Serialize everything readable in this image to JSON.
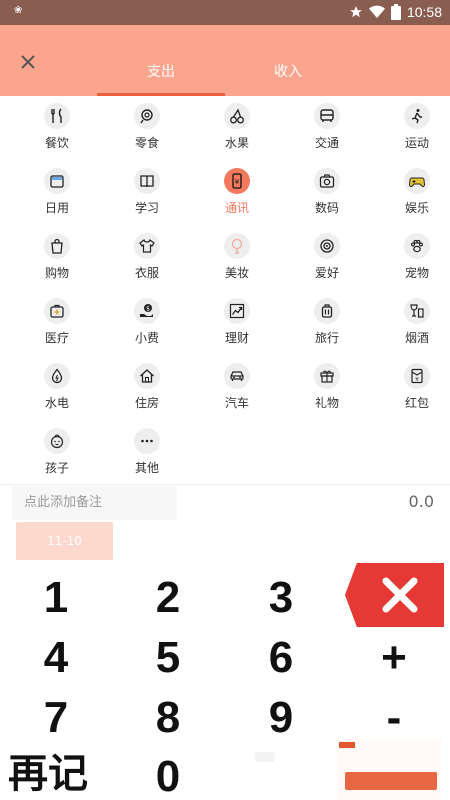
{
  "status_bar": {
    "time": "10:58"
  },
  "header": {
    "tabs": [
      {
        "label": "支出",
        "active": true
      },
      {
        "label": "收入",
        "active": false
      }
    ],
    "colors": {
      "header_bg": "#fca58e",
      "accent": "#ea5f3d",
      "selected_category": "#f2795d"
    }
  },
  "categories": [
    {
      "label": "餐饮",
      "icon": "fork-knife-icon"
    },
    {
      "label": "零食",
      "icon": "candy-icon"
    },
    {
      "label": "水果",
      "icon": "cherry-icon"
    },
    {
      "label": "交通",
      "icon": "bus-icon"
    },
    {
      "label": "运动",
      "icon": "running-icon"
    },
    {
      "label": "日用",
      "icon": "daily-box-icon"
    },
    {
      "label": "学习",
      "icon": "book-icon"
    },
    {
      "label": "通讯",
      "icon": "phone-icon",
      "active": true
    },
    {
      "label": "数码",
      "icon": "camera-icon"
    },
    {
      "label": "娱乐",
      "icon": "gamepad-icon"
    },
    {
      "label": "购物",
      "icon": "shopping-bag-icon"
    },
    {
      "label": "衣服",
      "icon": "shirt-icon"
    },
    {
      "label": "美妆",
      "icon": "mirror-icon"
    },
    {
      "label": "爱好",
      "icon": "target-icon"
    },
    {
      "label": "宠物",
      "icon": "paw-icon"
    },
    {
      "label": "医疗",
      "icon": "medical-kit-icon"
    },
    {
      "label": "小费",
      "icon": "tip-icon"
    },
    {
      "label": "理财",
      "icon": "trend-chart-icon"
    },
    {
      "label": "旅行",
      "icon": "luggage-icon"
    },
    {
      "label": "烟酒",
      "icon": "wine-icon"
    },
    {
      "label": "水电",
      "icon": "water-drop-icon"
    },
    {
      "label": "住房",
      "icon": "house-icon"
    },
    {
      "label": "汽车",
      "icon": "car-icon"
    },
    {
      "label": "礼物",
      "icon": "gift-icon"
    },
    {
      "label": "红包",
      "icon": "red-envelope-icon"
    },
    {
      "label": "孩子",
      "icon": "child-face-icon"
    },
    {
      "label": "其他",
      "icon": "more-dots-icon"
    }
  ],
  "note": {
    "placeholder": "点此添加备注"
  },
  "amount": "0.0",
  "date": "11-10",
  "keypad": {
    "digits": [
      "1",
      "2",
      "3",
      "4",
      "5",
      "6",
      "7",
      "8",
      "9",
      "0"
    ],
    "plus": "+",
    "minus": "-",
    "again": "再记",
    "delete_color": "#e53935"
  }
}
